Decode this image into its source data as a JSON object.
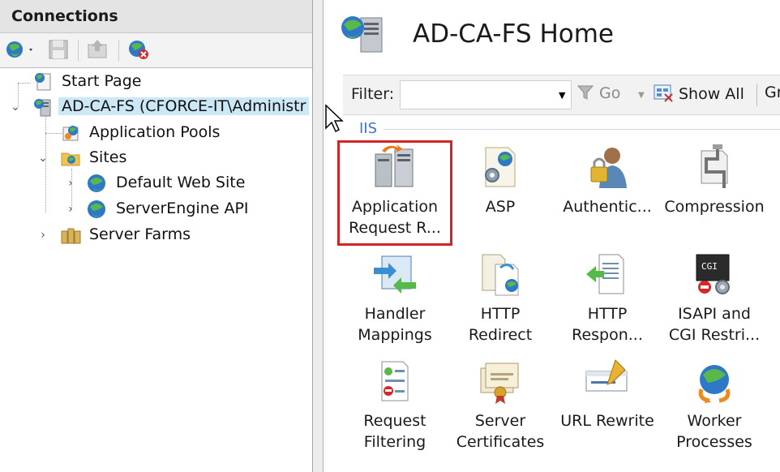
{
  "connections": {
    "title": "Connections",
    "toolbar": [
      {
        "name": "connect-icon",
        "label": ""
      },
      {
        "name": "save-icon",
        "label": ""
      },
      {
        "name": "up-icon",
        "label": ""
      },
      {
        "name": "delete-connection-icon",
        "label": ""
      }
    ],
    "tree": {
      "start_page": "Start Page",
      "server": "AD-CA-FS (CFORCE-IT\\Administr",
      "app_pools": "Application Pools",
      "sites": "Sites",
      "default_site": "Default Web Site",
      "serverengine": "ServerEngine API",
      "server_farms": "Server Farms"
    }
  },
  "main": {
    "title": "AD-CA-FS Home",
    "filter": {
      "label": "Filter:",
      "value": "",
      "go_label": "Go",
      "show_all_label": "Show All",
      "group_label": "Gr"
    },
    "section": "IIS",
    "features": [
      {
        "line1": "Application",
        "line2": "Request R...",
        "icon": "arr-server-icon",
        "selected": true
      },
      {
        "line1": "ASP",
        "line2": "",
        "icon": "asp-icon"
      },
      {
        "line1": "Authentic...",
        "line2": "",
        "icon": "authentication-icon"
      },
      {
        "line1": "Compression",
        "line2": "",
        "icon": "compression-icon"
      },
      {
        "line1": "Handler",
        "line2": "Mappings",
        "icon": "handler-mappings-icon"
      },
      {
        "line1": "HTTP",
        "line2": "Redirect",
        "icon": "http-redirect-icon"
      },
      {
        "line1": "HTTP",
        "line2": "Respon...",
        "icon": "http-response-icon"
      },
      {
        "line1": "ISAPI and",
        "line2": "CGI Restri...",
        "icon": "isapi-cgi-icon"
      },
      {
        "line1": "Request",
        "line2": "Filtering",
        "icon": "request-filtering-icon"
      },
      {
        "line1": "Server",
        "line2": "Certificates",
        "icon": "certificates-icon"
      },
      {
        "line1": "URL Rewrite",
        "line2": "",
        "icon": "url-rewrite-icon"
      },
      {
        "line1": "Worker",
        "line2": "Processes",
        "icon": "worker-processes-icon"
      }
    ]
  }
}
